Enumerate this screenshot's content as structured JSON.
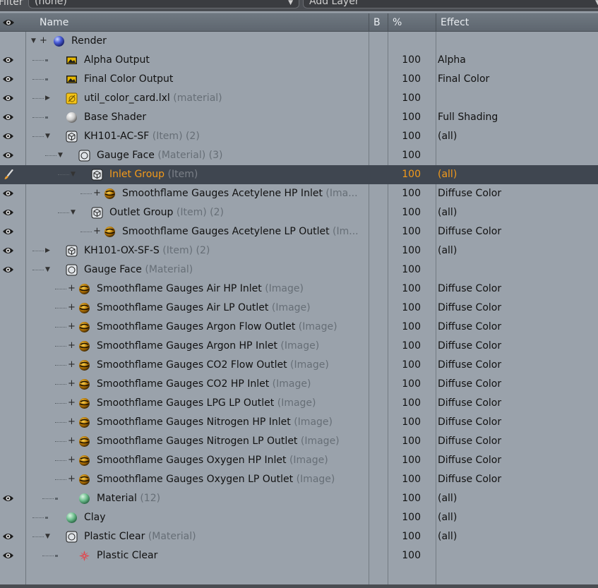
{
  "toolbar": {
    "filter_label": "Filter",
    "filter_value": "(none)",
    "add_layer_label": "Add Layer"
  },
  "columns": {
    "name": "Name",
    "b": "B",
    "pct": "%",
    "effect": "Effect"
  },
  "rows": [
    {
      "name": "Render",
      "sub": "",
      "pct": "",
      "effect": ""
    },
    {
      "name": "Alpha Output",
      "sub": "",
      "pct": "100",
      "effect": "Alpha"
    },
    {
      "name": "Final Color Output",
      "sub": "",
      "pct": "100",
      "effect": "Final Color"
    },
    {
      "name": "util_color_card.lxl",
      "sub": "(material)",
      "pct": "100",
      "effect": ""
    },
    {
      "name": "Base Shader",
      "sub": "",
      "pct": "100",
      "effect": "Full Shading"
    },
    {
      "name": "KH101-AC-SF",
      "sub": "(Item) (2)",
      "pct": "100",
      "effect": "(all)"
    },
    {
      "name": "Gauge Face",
      "sub": "(Material) (3)",
      "pct": "100",
      "effect": ""
    },
    {
      "name": "Inlet Group",
      "sub": "(Item)",
      "pct": "100",
      "effect": "(all)"
    },
    {
      "name": "Smoothflame Gauges Acetylene HP Inlet",
      "sub": "(Ima...",
      "pct": "100",
      "effect": "Diffuse Color"
    },
    {
      "name": "Outlet Group",
      "sub": "(Item) (2)",
      "pct": "100",
      "effect": "(all)"
    },
    {
      "name": "Smoothflame Gauges Acetylene LP Outlet",
      "sub": "(Im...",
      "pct": "100",
      "effect": "Diffuse Color"
    },
    {
      "name": "KH101-OX-SF-S",
      "sub": "(Item) (2)",
      "pct": "100",
      "effect": "(all)"
    },
    {
      "name": "Gauge Face",
      "sub": "(Material)",
      "pct": "100",
      "effect": ""
    },
    {
      "name": "Smoothflame Gauges Air HP Inlet",
      "sub": "(Image)",
      "pct": "100",
      "effect": "Diffuse Color"
    },
    {
      "name": "Smoothflame Gauges Air LP Outlet",
      "sub": "(Image)",
      "pct": "100",
      "effect": "Diffuse Color"
    },
    {
      "name": "Smoothflame Gauges Argon Flow Outlet",
      "sub": "(Image)",
      "pct": "100",
      "effect": "Diffuse Color"
    },
    {
      "name": "Smoothflame Gauges Argon HP Inlet",
      "sub": "(Image)",
      "pct": "100",
      "effect": "Diffuse Color"
    },
    {
      "name": "Smoothflame Gauges CO2 Flow Outlet",
      "sub": "(Image)",
      "pct": "100",
      "effect": "Diffuse Color"
    },
    {
      "name": "Smoothflame Gauges CO2 HP Inlet",
      "sub": "(Image)",
      "pct": "100",
      "effect": "Diffuse Color"
    },
    {
      "name": "Smoothflame Gauges LPG LP Outlet",
      "sub": "(Image)",
      "pct": "100",
      "effect": "Diffuse Color"
    },
    {
      "name": "Smoothflame Gauges Nitrogen HP Inlet",
      "sub": "(Image)",
      "pct": "100",
      "effect": "Diffuse Color"
    },
    {
      "name": "Smoothflame Gauges Nitrogen LP Outlet",
      "sub": "(Image)",
      "pct": "100",
      "effect": "Diffuse Color"
    },
    {
      "name": "Smoothflame Gauges Oxygen HP Inlet",
      "sub": "(Image)",
      "pct": "100",
      "effect": "Diffuse Color"
    },
    {
      "name": "Smoothflame Gauges Oxygen LP Outlet",
      "sub": "(Image)",
      "pct": "100",
      "effect": "Diffuse Color"
    },
    {
      "name": "Material",
      "sub": "(12)",
      "pct": "100",
      "effect": "(all)"
    },
    {
      "name": "Clay",
      "sub": "",
      "pct": "100",
      "effect": "(all)"
    },
    {
      "name": "Plastic Clear",
      "sub": "(Material)",
      "pct": "100",
      "effect": "(all)"
    },
    {
      "name": "Plastic Clear",
      "sub": "",
      "pct": "100",
      "effect": ""
    }
  ],
  "colors": {
    "background": "#9aa2ab",
    "selection": "#3f4650",
    "selected_text": "#f39a1a",
    "subtext": "#666e76"
  }
}
